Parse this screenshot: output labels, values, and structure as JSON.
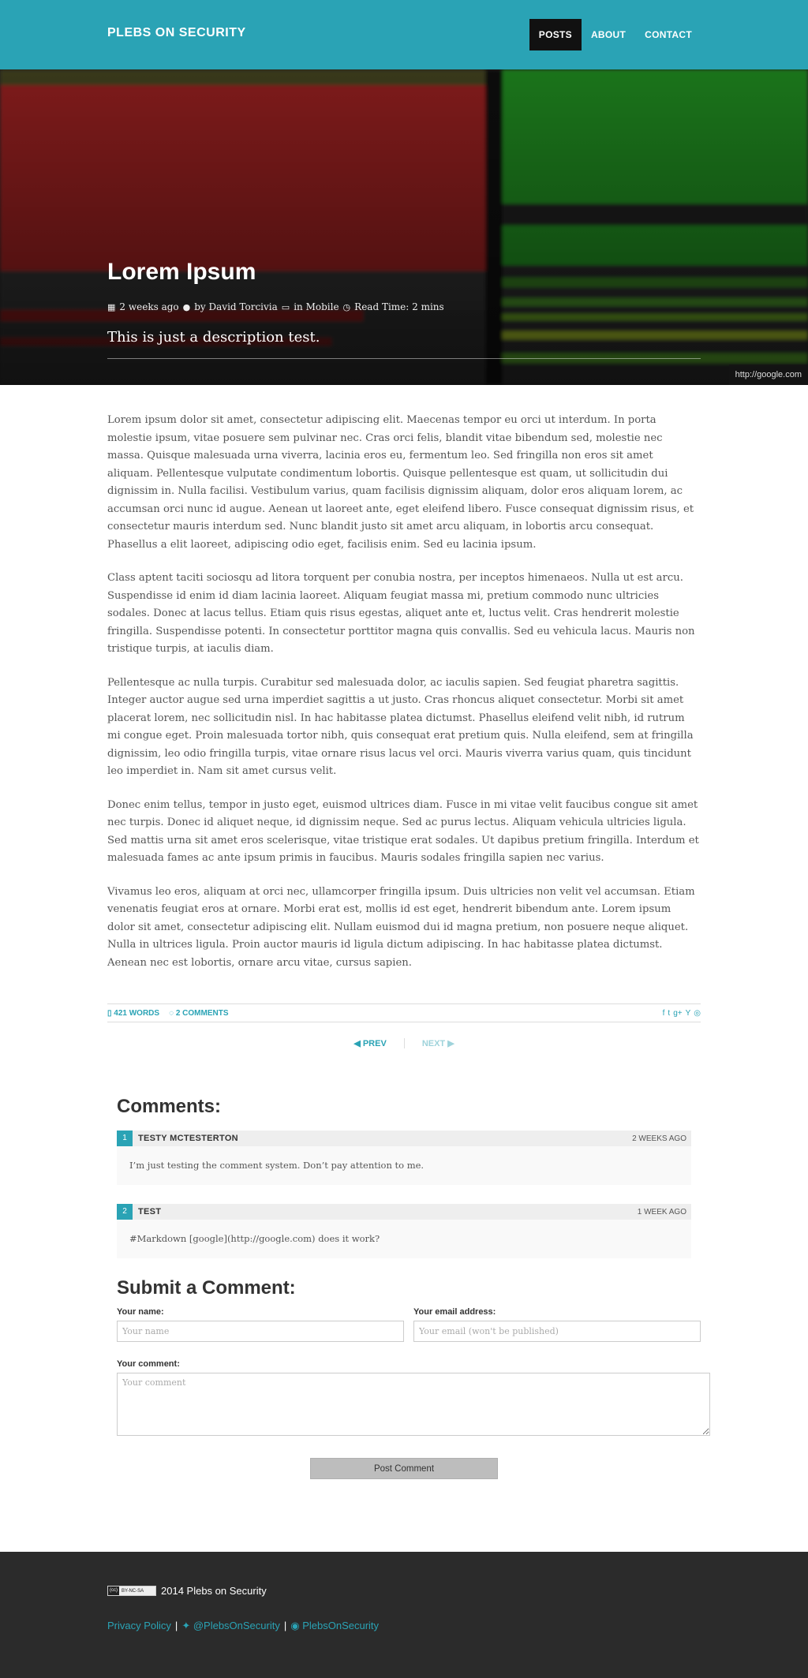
{
  "header": {
    "brand": "PLEBS ON SECURITY",
    "nav": [
      "POSTS",
      "ABOUT",
      "CONTACT"
    ]
  },
  "hero": {
    "title": "Lorem Ipsum",
    "date": "2 weeks ago",
    "author": "by David Torcivia",
    "category": "in Mobile",
    "read_time": "Read Time: 2 mins",
    "description": "This is just a description test.",
    "image_credit": "http://google.com"
  },
  "article": {
    "paragraphs": [
      "Lorem ipsum dolor sit amet, consectetur adipiscing elit. Maecenas tempor eu orci ut interdum. In porta molestie ipsum, vitae posuere sem pulvinar nec. Cras orci felis, blandit vitae bibendum sed, molestie nec massa. Quisque malesuada urna viverra, lacinia eros eu, fermentum leo. Sed fringilla non eros sit amet aliquam. Pellentesque vulputate condimentum lobortis. Quisque pellentesque est quam, ut sollicitudin dui dignissim in. Nulla facilisi. Vestibulum varius, quam facilisis dignissim aliquam, dolor eros aliquam lorem, ac accumsan orci nunc id augue. Aenean ut laoreet ante, eget eleifend libero. Fusce consequat dignissim risus, et consectetur mauris interdum sed. Nunc blandit justo sit amet arcu aliquam, in lobortis arcu consequat. Phasellus a elit laoreet, adipiscing odio eget, facilisis enim. Sed eu lacinia ipsum.",
      "Class aptent taciti sociosqu ad litora torquent per conubia nostra, per inceptos himenaeos. Nulla ut est arcu. Suspendisse id enim id diam lacinia laoreet. Aliquam feugiat massa mi, pretium commodo nunc ultricies sodales. Donec at lacus tellus. Etiam quis risus egestas, aliquet ante et, luctus velit. Cras hendrerit molestie fringilla. Suspendisse potenti. In consectetur porttitor magna quis convallis. Sed eu vehicula lacus. Mauris non tristique turpis, at iaculis diam.",
      "Pellentesque ac nulla turpis. Curabitur sed malesuada dolor, ac iaculis sapien. Sed feugiat pharetra sagittis. Integer auctor augue sed urna imperdiet sagittis a ut justo. Cras rhoncus aliquet consectetur. Morbi sit amet placerat lorem, nec sollicitudin nisl. In hac habitasse platea dictumst. Phasellus eleifend velit nibh, id rutrum mi congue eget. Proin malesuada tortor nibh, quis consequat erat pretium quis. Nulla eleifend, sem at fringilla dignissim, leo odio fringilla turpis, vitae ornare risus lacus vel orci. Mauris viverra varius quam, quis tincidunt leo imperdiet in. Nam sit amet cursus velit.",
      "Donec enim tellus, tempor in justo eget, euismod ultrices diam. Fusce in mi vitae velit faucibus congue sit amet nec turpis. Donec id aliquet neque, id dignissim neque. Sed ac purus lectus. Aliquam vehicula ultricies ligula. Sed mattis urna sit amet eros scelerisque, vitae tristique erat sodales. Ut dapibus pretium fringilla. Interdum et malesuada fames ac ante ipsum primis in faucibus. Mauris sodales fringilla sapien nec varius.",
      "Vivamus leo eros, aliquam at orci nec, ullamcorper fringilla ipsum. Duis ultricies non velit vel accumsan. Etiam venenatis feugiat eros at ornare. Morbi erat est, mollis id est eget, hendrerit bibendum ante. Lorem ipsum dolor sit amet, consectetur adipiscing elit. Nullam euismod dui id magna pretium, non posuere neque aliquet. Nulla in ultrices ligula. Proin auctor mauris id ligula dictum adipiscing. In hac habitasse platea dictumst. Aenean nec est lobortis, ornare arcu vitae, cursus sapien."
    ],
    "word_count": "421 WORDS",
    "comment_count": "2 COMMENTS",
    "share_icons": [
      "f",
      "t",
      "g+",
      "Y",
      "reddit"
    ]
  },
  "pager": {
    "prev": "PREV",
    "next": "NEXT"
  },
  "comments": {
    "title": "Comments:",
    "items": [
      {
        "num": "1",
        "author": "TESTY MCTESTERTON",
        "date": "2 WEEKS AGO",
        "body": "I’m just testing the comment system. Don’t pay attention to me."
      },
      {
        "num": "2",
        "author": "TEST",
        "date": "1 WEEK AGO",
        "body": "#Markdown [google](http://google.com) does it work?"
      }
    ]
  },
  "form": {
    "title": "Submit a Comment:",
    "name_label": "Your name:",
    "name_placeholder": "Your name",
    "email_label": "Your email address:",
    "email_placeholder": "Your email (won't be published)",
    "comment_label": "Your comment:",
    "comment_placeholder": "Your comment",
    "submit": "Post Comment"
  },
  "footer": {
    "license_badge_left": "(cc)",
    "license_badge_right": "BY-NC-SA",
    "copyright": "2014 Plebs on Security",
    "privacy": "Privacy Policy",
    "twitter": "@PlebsOnSecurity",
    "github": "PlebsOnSecurity",
    "separator": "|"
  },
  "colors": {
    "accent": "#2aa3b5",
    "footer_bg": "#2b2b2b",
    "nav_active": "#111111"
  }
}
